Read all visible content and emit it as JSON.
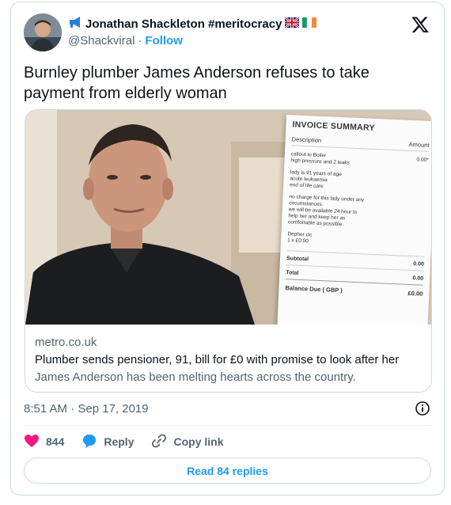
{
  "author": {
    "name": "Jonathan Shackleton #meritocracy",
    "handle": "@Shackviral",
    "separator": "·",
    "follow_label": "Follow",
    "flags": [
      "uk-flag",
      "ireland-flag"
    ]
  },
  "tweet": {
    "text": "Burnley plumber James Anderson refuses to take payment from elderly woman",
    "timestamp": "8:51 AM · Sep 17, 2019"
  },
  "link_card": {
    "domain": "metro.co.uk",
    "title": "Plumber sends pensioner, 91, bill for £0 with promise to look after her",
    "description": "James Anderson has been melting hearts across the country."
  },
  "invoice": {
    "title": "INVOICE SUMMARY",
    "col_description": "Description",
    "col_amount": "Amount",
    "line1a": "callout to Boiler",
    "line1b": "high pressure and 2 leaks",
    "line1_amount": "0.00*",
    "line2a": "lady is 91 years of age",
    "line2b": "acute leukaemia",
    "line2c": "end of life care",
    "line3a": "no charge for this lady under any",
    "line3b": "circumstances.",
    "line3c": "we will be available 24 hour to",
    "line3d": "help her and keep her as",
    "line3e": "comfortable as possible.",
    "line4a": "Depher cic",
    "line4b": "1 x £0.00",
    "subtotal_label": "Subtotal",
    "subtotal_value": "0.00",
    "total_label": "Total",
    "total_value": "0.00",
    "balance_label": "Balance Due ( GBP )",
    "balance_value": "£0.00"
  },
  "actions": {
    "likes_count": "844",
    "reply_label": "Reply",
    "copy_label": "Copy link"
  },
  "replies_button": "Read 84 replies",
  "colors": {
    "accent": "#1d9bf0",
    "like": "#f91880",
    "secondary_text": "#536471",
    "border": "#cfd9de"
  }
}
